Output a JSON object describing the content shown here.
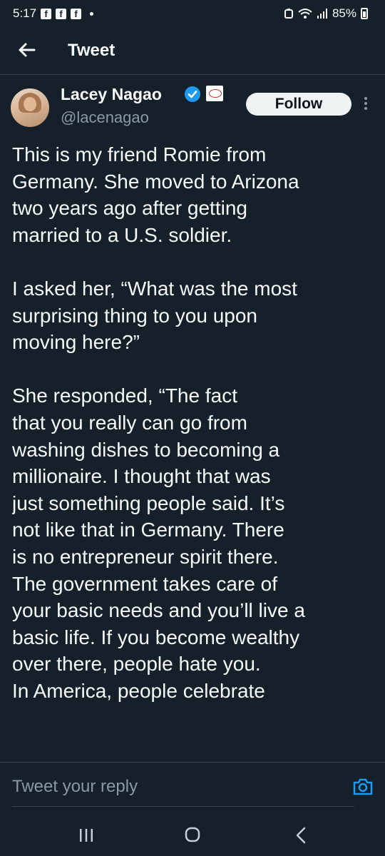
{
  "status_bar": {
    "time": "5:17",
    "notification_icons": [
      "facebook-icon",
      "facebook-icon",
      "facebook-icon"
    ],
    "battery": "85%"
  },
  "header": {
    "title": "Tweet"
  },
  "tweet": {
    "author_name": "Lacey Nagao",
    "author_handle": "@lacenagao",
    "verified": true,
    "follow_label": "Follow",
    "paragraphs": [
      "This is my friend Romie from\nGermany. She moved to Arizona\ntwo years ago after getting\nmarried to a U.S. soldier.",
      "I asked her, “What was the most\nsurprising thing to you upon\nmoving here?”",
      "She responded, “The fact\nthat you really can go from\nwashing dishes to becoming a\nmillionaire. I thought that was\njust something people said. It’s\nnot like that in Germany. There\nis no entrepreneur spirit there.\nThe government takes care of\nyour basic needs and you’ll live a\nbasic life. If you become wealthy\nover there, people hate you.\nIn America, people celebrate"
    ]
  },
  "reply": {
    "placeholder": "Tweet your reply"
  },
  "colors": {
    "background": "#15202b",
    "text": "#f7f9f9",
    "secondary_text": "#8b98a5",
    "accent": "#1d9bf0"
  }
}
